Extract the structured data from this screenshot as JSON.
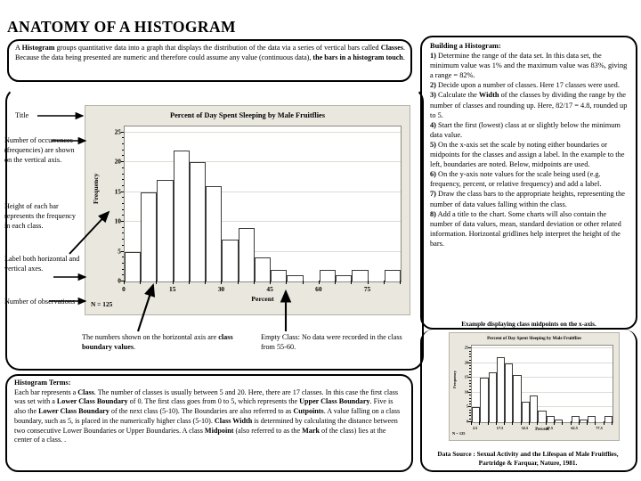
{
  "page_title": "ANATOMY OF A HISTOGRAM",
  "intro": {
    "text": "A Histogram groups quantitative data into a graph that displays the distribution of the data via a series of vertical bars called Classes. Because the data being presented are numeric and therefore could assume any value (continuous data), the bars in a histogram touch."
  },
  "building": {
    "heading": "Building a Histogram:",
    "steps": [
      "1) Determine the range of the data set. In this data set, the minimum value was 1% and the maximum value was 83%, giving a range = 82%.",
      "2) Decide upon a number of classes.  Here 17 classes were used.",
      "3) Calculate the Width of the classes by dividing the range by the number of classes and rounding up. Here, 82/17 = 4.8, rounded up to 5.",
      "4) Start the first (lowest) class at or slightly below the minimum data value.",
      "5) On the x-axis set the scale by noting either boundaries or midpoints for the classes and assign a label. In the example to the left, boundaries are noted. Below, midpoints are used.",
      "6) On the y-axis note values for the scale being used (e.g. frequency, percent, or relative frequency) and add a label.",
      "7) Draw the class bars to the appropriate heights, representing the number of data values falling within the class.",
      "8) Add a title to the chart.  Some charts will also contain the number of data values, mean, standard deviation or other related information.  Horizontal gridlines help interpret the height of the bars."
    ]
  },
  "annotations": {
    "title": "Title",
    "frequency": "Number of occurrences (frequencies) are shown on the vertical axis.",
    "height": "Height of each bar represents the frequency in each class.",
    "label_axes": "Label both horizontal and vertical axes.",
    "observations": "Number of observations",
    "boundary": "The numbers shown on the horizontal axis are class boundary values.",
    "empty_class": "Empty Class: No data were recorded in the class from 55-60."
  },
  "terms": {
    "heading": "Histogram Terms:",
    "body": "Each bar represents a Class.  The number of classes is usually between 5 and 20.  Here, there are 17 classes.  In this case the first class was set with a Lower Class Boundary of 0.  The first class goes from 0 to 5, which represents the Upper Class Boundary. Five is also the Lower Class Boundary of the next class (5-10).  The Boundaries are also referred to as Cutpoints.   A value falling on a class boundary, such as 5, is placed in the numerically higher class (5-10).  Class Width is determined by calculating the distance between two consecutive Lower Boundaries or Upper Boundaries.  A class Midpoint (also referred to as the Mark of the class) lies at the center of a class.   ."
  },
  "mini": {
    "caption": "Example displaying class midpoints on the x-axis.",
    "source": "Data Source : Sexual Activity and the Lifespan of Male Fruitflies, Partridge & Farquar, Nature, 1981."
  },
  "chart_data": [
    {
      "id": "main",
      "type": "bar",
      "title": "Percent of Day Spent Sleeping by Male Fruitflies",
      "xlabel": "Percent",
      "ylabel": "Frequency",
      "n_label": "N = 125",
      "bin_width": 5,
      "bin_starts": [
        0,
        5,
        10,
        15,
        20,
        25,
        30,
        35,
        40,
        45,
        50,
        55,
        60,
        65,
        70,
        75,
        80
      ],
      "categories": [
        "0-5",
        "5-10",
        "10-15",
        "15-20",
        "20-25",
        "25-30",
        "30-35",
        "35-40",
        "40-45",
        "45-50",
        "50-55",
        "55-60",
        "60-65",
        "65-70",
        "70-75",
        "75-80",
        "80-85"
      ],
      "values": [
        5,
        15,
        17,
        22,
        20,
        16,
        7,
        9,
        4,
        2,
        1,
        0,
        2,
        1,
        2,
        0,
        2
      ],
      "xlim": [
        0,
        85
      ],
      "ylim": [
        0,
        26
      ],
      "xticks": [
        0,
        15,
        30,
        45,
        60,
        75
      ],
      "xtick_labels": [
        "0",
        "15",
        "30",
        "45",
        "60",
        "75"
      ],
      "yticks": [
        0,
        5,
        10,
        15,
        20,
        25
      ],
      "ytick_labels": [
        "0",
        "5",
        "10",
        "15",
        "20",
        "25"
      ],
      "grid": "horizontal",
      "legend": "none"
    },
    {
      "id": "mini",
      "type": "bar",
      "title": "Percent of Day Spent Sleeping by Male Fruitflies",
      "xlabel": "Percent",
      "ylabel": "Frequency",
      "n_label": "N = 125",
      "bin_width": 5,
      "categories": [
        "2.5",
        "7.5",
        "12.5",
        "17.5",
        "22.5",
        "27.5",
        "32.5",
        "37.5",
        "42.5",
        "47.5",
        "52.5",
        "57.5",
        "62.5",
        "67.5",
        "72.5",
        "77.5",
        "82.5"
      ],
      "values": [
        5,
        15,
        17,
        22,
        20,
        16,
        7,
        9,
        4,
        2,
        1,
        0,
        2,
        1,
        2,
        0,
        2
      ],
      "xlim": [
        0,
        85
      ],
      "ylim": [
        0,
        26
      ],
      "xticks": [
        2.5,
        17.5,
        32.5,
        47.5,
        62.5,
        77.5
      ],
      "xtick_labels": [
        "2.5",
        "17.5",
        "32.5",
        "47.5",
        "62.5",
        "77.5"
      ],
      "yticks": [
        0,
        5,
        10,
        15,
        20,
        25
      ],
      "ytick_labels": [
        "0",
        "5",
        "10",
        "15",
        "20",
        "25"
      ],
      "grid": "horizontal",
      "legend": "none"
    }
  ],
  "colors": {
    "chart_background": "#eae7de",
    "plot_background": "#ffffff",
    "bar_outline": "#3a3a38",
    "gridline": "#dedbd2",
    "text": "#000000"
  }
}
